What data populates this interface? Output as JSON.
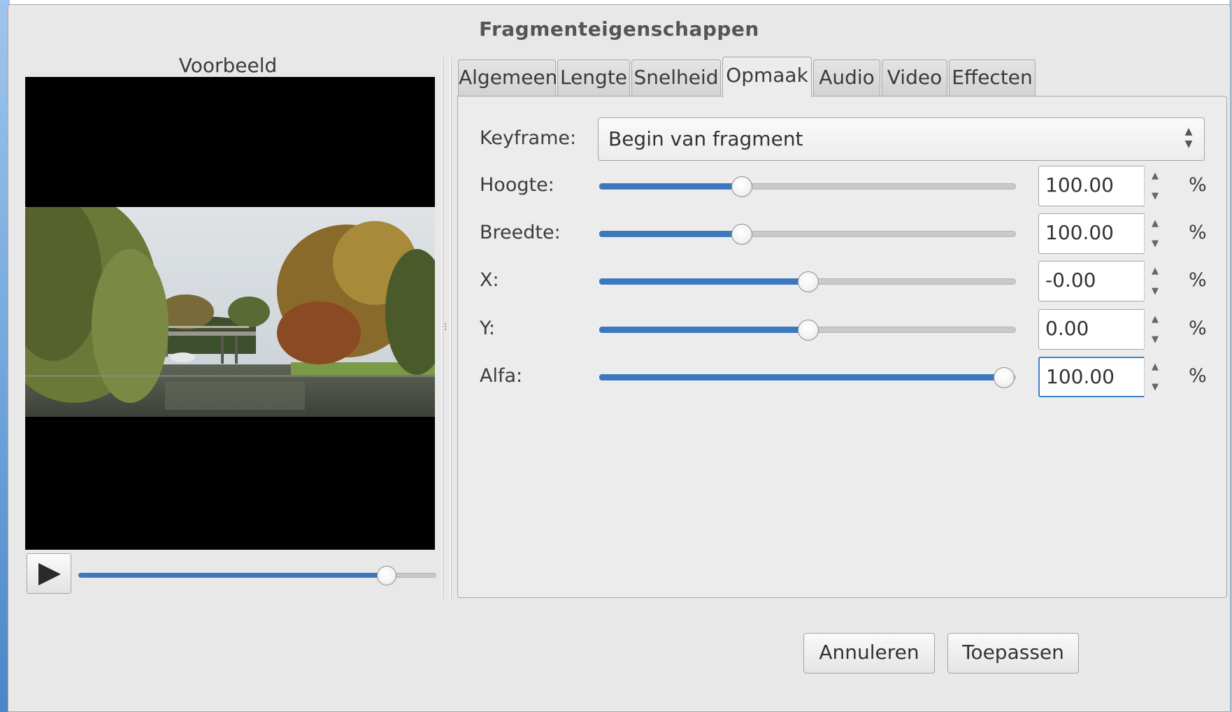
{
  "dialog": {
    "title": "Fragmenteigenschappen"
  },
  "preview": {
    "label": "Voorbeeld",
    "seek_position": 0.86
  },
  "tabs": [
    {
      "label": "Algemeen",
      "active": false
    },
    {
      "label": "Lengte",
      "active": false
    },
    {
      "label": "Snelheid",
      "active": false
    },
    {
      "label": "Opmaak",
      "active": true
    },
    {
      "label": "Audio",
      "active": false
    },
    {
      "label": "Video",
      "active": false
    },
    {
      "label": "Effecten",
      "active": false
    }
  ],
  "layout_tab": {
    "keyframe_label": "Keyframe:",
    "keyframe_value": "Begin van fragment",
    "rows": [
      {
        "label": "Hoogte:",
        "value": "100.00",
        "unit": "%",
        "slider_fraction": 0.34,
        "focused": false
      },
      {
        "label": "Breedte:",
        "value": "100.00",
        "unit": "%",
        "slider_fraction": 0.34,
        "focused": false
      },
      {
        "label": "X:",
        "value": "-0.00",
        "unit": "%",
        "slider_fraction": 0.5,
        "focused": false
      },
      {
        "label": "Y:",
        "value": "0.00",
        "unit": "%",
        "slider_fraction": 0.5,
        "focused": false
      },
      {
        "label": "Alfa:",
        "value": "100.00",
        "unit": "%",
        "slider_fraction": 0.97,
        "focused": true
      }
    ]
  },
  "buttons": {
    "cancel_label": "Annuleren",
    "apply_label": "Toepassen"
  },
  "icons": {
    "play": "play-icon",
    "spin_up": "spin-up-icon",
    "spin_down": "spin-down-icon",
    "combo": "combo-arrows-icon"
  },
  "colors": {
    "accent": "#3d78bd",
    "dialog_bg": "#e8e8e8"
  }
}
